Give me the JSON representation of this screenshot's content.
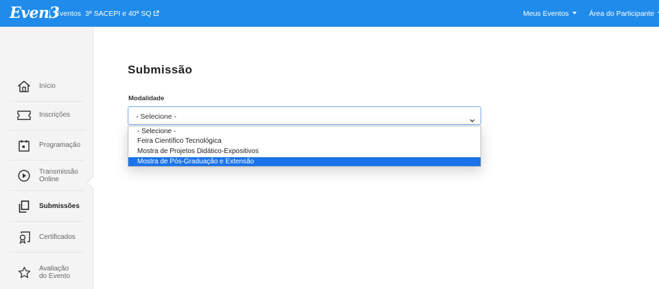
{
  "header": {
    "logo_text": "Even3",
    "eventos_label": "Eventos",
    "event_name": "3ª SACEPI e 40ª SQ",
    "menu_meus_eventos": "Meus Eventos",
    "menu_area_participante": "Área do Participante",
    "bg_color": "#1f8bea"
  },
  "sidebar": {
    "items": [
      {
        "label": "Início",
        "icon": "home-icon"
      },
      {
        "label": "Inscrições",
        "icon": "ticket-icon"
      },
      {
        "label": "Programação",
        "icon": "calendar-icon"
      },
      {
        "label": "Transmissão Online",
        "line1": "Transmissão",
        "line2": "Online",
        "icon": "play-circle-icon"
      },
      {
        "label": "Submissões",
        "icon": "documents-icon",
        "active": true
      },
      {
        "label": "Certificados",
        "icon": "certificate-icon"
      },
      {
        "label": "Avaliação do Evento",
        "line1": "Avaliação",
        "line2": "do Evento",
        "icon": "star-icon"
      }
    ]
  },
  "main": {
    "title": "Submissão",
    "modalidade_label": "Modalidade",
    "select_value": "- Selecione -",
    "options": [
      "- Selecione -",
      "Feira Científico Tecnológica",
      "Mostra de Projetos Didático-Expositivos",
      "Mostra de Pós-Graduação e Extensão"
    ],
    "highlighted_option_index": 3,
    "highlight_color": "#1a73e8"
  }
}
